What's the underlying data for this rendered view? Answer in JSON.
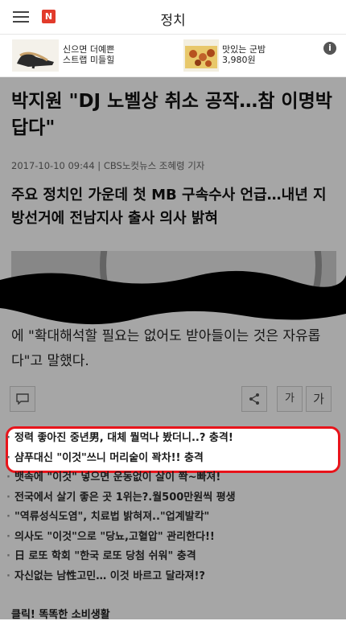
{
  "header": {
    "section_title": "정치",
    "logo_letter": "N"
  },
  "ad": {
    "item1": {
      "line1": "신으면 더예쁜",
      "line2": "스트랩 미들힐"
    },
    "item2": {
      "line1": "맛있는 군밤",
      "line2": "3,980원"
    },
    "info_icon": "i"
  },
  "article": {
    "headline": "박지원 \"DJ 노벨상 취소 공작…참 이명박답다\"",
    "byline": "2017-10-10 09:44 | CBS노컷뉴스 조혜령 기자",
    "subhead": "주요 정치인 가운데 첫 MB 구속수사 언급…내년 지방선거에 전남지사 출사 의사 밝혀",
    "body": "에 \"확대해석할 필요는 없어도 받아들이는 것은 자유롭다\"고 말했다."
  },
  "toolbar": {
    "font_small": "가",
    "font_large": "가"
  },
  "links": [
    "정력 좋아진 중년男, 대체 뭘먹나 봤더니..? 충격!",
    "샴푸대신 \"이것\"쓰니 머리숱이 꽉차!! 충격",
    "뱃속에 \"이것\" 넣으면 운동없이 살이 쫙~빠져!",
    "전국에서 살기 좋은 곳 1위는?.월500만원씩 평생",
    "\"역류성식도염\", 치료법 밝혀져..\"업계발칵\"",
    "의사도 \"이것\"으로 \"당뇨,고혈압\" 관리한다!!",
    "日 로또 학회 \"한국 로또 당첨 쉬워\" 충격",
    "자신없는 남性고민… 이것 바르고 달라져!?"
  ],
  "footer_label": "클릭! 똑똑한 소비생활",
  "colors": {
    "highlight_border": "#e8141b",
    "logo_bg": "#e23b2b"
  }
}
